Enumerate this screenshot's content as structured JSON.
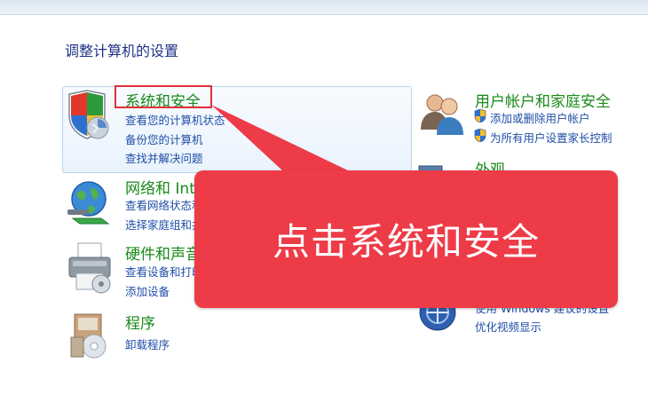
{
  "window": {
    "title_strip": ""
  },
  "page_title": "调整计算机的设置",
  "categories": {
    "system": {
      "heading": "系统和安全",
      "links": [
        "查看您的计算机状态",
        "备份您的计算机",
        "查找并解决问题"
      ],
      "icon": "shield-icon"
    },
    "network": {
      "heading": "网络和 Internet",
      "links": [
        "查看网络状态和任务",
        "选择家庭组和共享选项"
      ],
      "icon": "network-globe-icon"
    },
    "hardware": {
      "heading": "硬件和声音",
      "links": [
        "查看设备和打印机",
        "添加设备"
      ],
      "icon": "printer-icon"
    },
    "programs": {
      "heading": "程序",
      "links": [
        "卸载程序"
      ],
      "icon": "programs-box-icon"
    },
    "users": {
      "heading": "用户帐户和家庭安全",
      "links": [
        "添加或删除用户帐户",
        "为所有用户设置家长控制"
      ],
      "icon": "users-icon"
    },
    "appearance": {
      "heading": "外观",
      "icon": "appearance-icon"
    },
    "ease": {
      "links": [
        "使用 Windows 建议的设置",
        "优化视频显示"
      ],
      "icon": "ease-of-access-icon"
    }
  },
  "callout": {
    "text": "点击系统和安全"
  },
  "colors": {
    "callout": "#ee3b48",
    "highlight": "#e0303a",
    "heading_green": "#1a8a1a",
    "link_blue": "#1f4fa8",
    "title_blue": "#1e3287"
  }
}
